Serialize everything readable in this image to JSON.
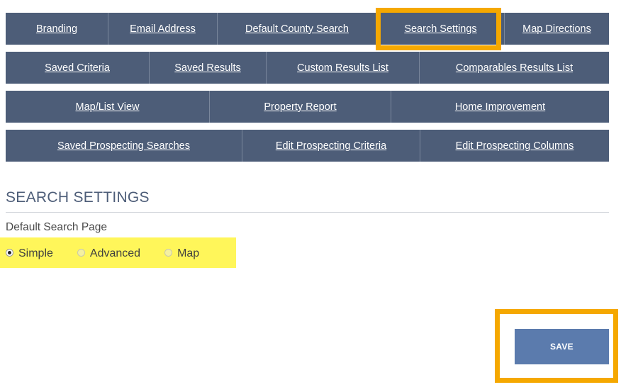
{
  "nav": {
    "row1": [
      "Branding",
      "Email Address",
      "Default County Search",
      "Search Settings",
      "Map Directions"
    ],
    "row2": [
      "Saved Criteria",
      "Saved Results",
      "Custom Results List",
      "Comparables Results List"
    ],
    "row3": [
      "Map/List View",
      "Property Report",
      "Home Improvement"
    ],
    "row4": [
      "Saved Prospecting Searches",
      "Edit Prospecting Criteria",
      "Edit Prospecting Columns"
    ],
    "active": "Search Settings"
  },
  "section": {
    "title": "SEARCH SETTINGS",
    "field_label": "Default Search Page",
    "options": [
      {
        "label": "Simple",
        "checked": true
      },
      {
        "label": "Advanced",
        "checked": false
      },
      {
        "label": "Map",
        "checked": false
      }
    ]
  },
  "save_label": "SAVE",
  "colors": {
    "nav_bg": "#4d5d78",
    "highlight_orange": "#f5a800",
    "highlight_yellow": "#fff65a",
    "save_bg": "#5b7bad"
  }
}
